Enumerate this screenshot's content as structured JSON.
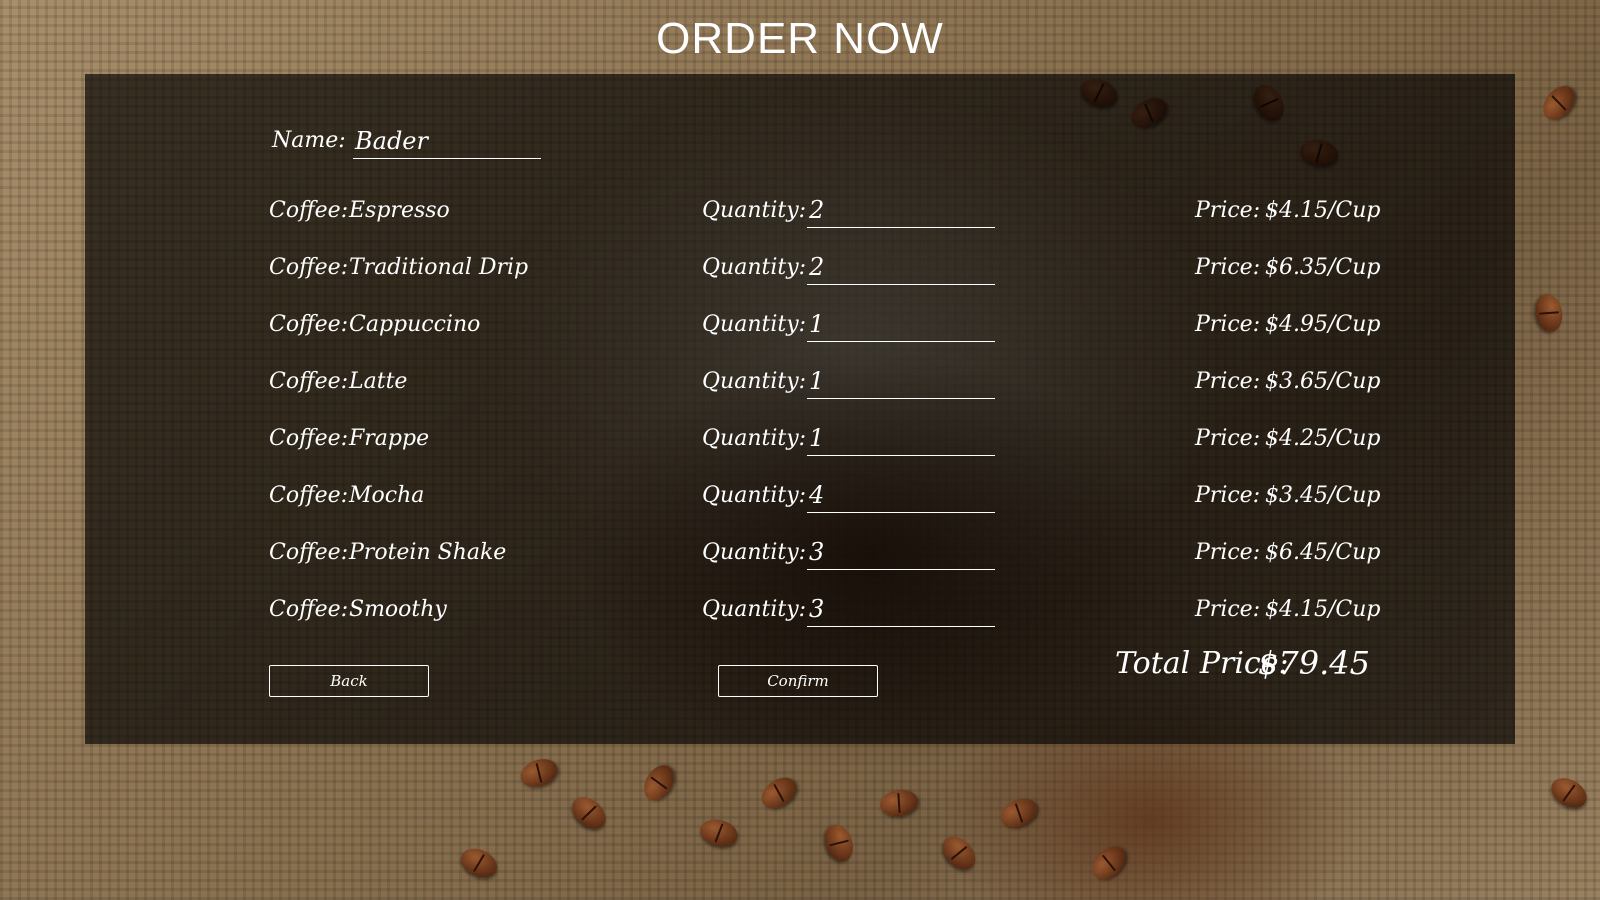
{
  "page": {
    "title": "ORDER NOW"
  },
  "form": {
    "name_label": "Name:",
    "name_value": "Bader",
    "coffee_label": "Coffee:",
    "quantity_label": "Quantity:",
    "price_label": "Price:",
    "items": [
      {
        "coffee": "Espresso",
        "quantity": "2",
        "price": "$4.15/Cup"
      },
      {
        "coffee": "Traditional Drip",
        "quantity": "2",
        "price": "$6.35/Cup"
      },
      {
        "coffee": "Cappuccino",
        "quantity": "1",
        "price": "$4.95/Cup"
      },
      {
        "coffee": "Latte",
        "quantity": "1",
        "price": "$3.65/Cup"
      },
      {
        "coffee": "Frappe",
        "quantity": "1",
        "price": "$4.25/Cup"
      },
      {
        "coffee": "Mocha",
        "quantity": "4",
        "price": "$3.45/Cup"
      },
      {
        "coffee": "Protein Shake",
        "quantity": "3",
        "price": "$6.45/Cup"
      },
      {
        "coffee": "Smoothy",
        "quantity": "3",
        "price": "$4.15/Cup"
      }
    ],
    "back_label": "Back",
    "confirm_label": "Confirm",
    "total_label": "Total Price:",
    "total_value": "$79.45"
  },
  "colors": {
    "panel_overlay": "#000000",
    "text": "#ffffff"
  }
}
